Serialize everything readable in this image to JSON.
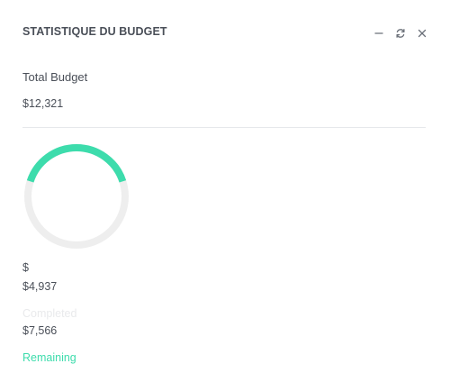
{
  "card": {
    "title": "STATISTIQUE DU BUDGET",
    "tools": [
      {
        "name": "minimize-icon"
      },
      {
        "name": "refresh-icon"
      },
      {
        "name": "close-icon"
      }
    ]
  },
  "total": {
    "label": "Total Budget",
    "value": "$12,321"
  },
  "donut": {
    "completed_fraction": 0.4,
    "completed_color": "#3ddcac",
    "track_color": "#eeeeee"
  },
  "breakdown": {
    "currency_symbol": "$",
    "completed_value": "$4,937",
    "completed_label": "Completed",
    "remaining_value": "$7,566",
    "remaining_label": "Remaining"
  },
  "colors": {
    "accent": "#3ddcac",
    "text": "#4a4f58",
    "muted": "#e9eaec"
  }
}
